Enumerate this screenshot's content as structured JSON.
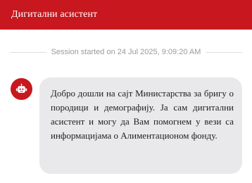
{
  "header": {
    "title": "Дигитални асистент"
  },
  "session": {
    "started_text": "Session started on 24 Jul 2025, 9:09:20 AM"
  },
  "messages": [
    {
      "sender_icon": "robot-icon",
      "text": "Добро дошли на сајт Министарства за бригу о породици и демографију. Ја сам дигитални асистент и могу да Вам помогнем у вези са информацијама о Алиментационом фонду."
    }
  ],
  "colors": {
    "brand": "#c8171e",
    "bubble": "#e9e9eb",
    "divider": "#dedede",
    "muted_text": "#9a9a9a"
  }
}
